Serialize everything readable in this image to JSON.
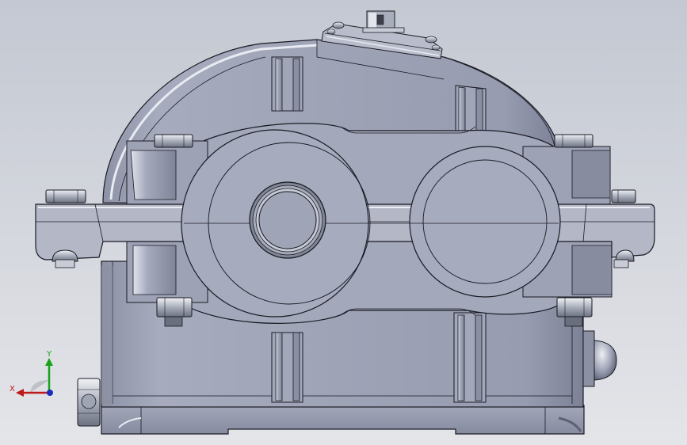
{
  "viewport": {
    "background_top": "#c3c8d2",
    "background_bottom": "#e4e5e9"
  },
  "model": {
    "body_color": "#9ea3b6",
    "edge_color": "#1a1a24",
    "highlight_color": "#e9ebf3",
    "shadow_color": "#6c7184"
  },
  "triad": {
    "x_label": "X",
    "y_label": "Y",
    "x_color": "#c01a1a",
    "y_color": "#17a31a",
    "z_color": "#1a2dc0"
  }
}
